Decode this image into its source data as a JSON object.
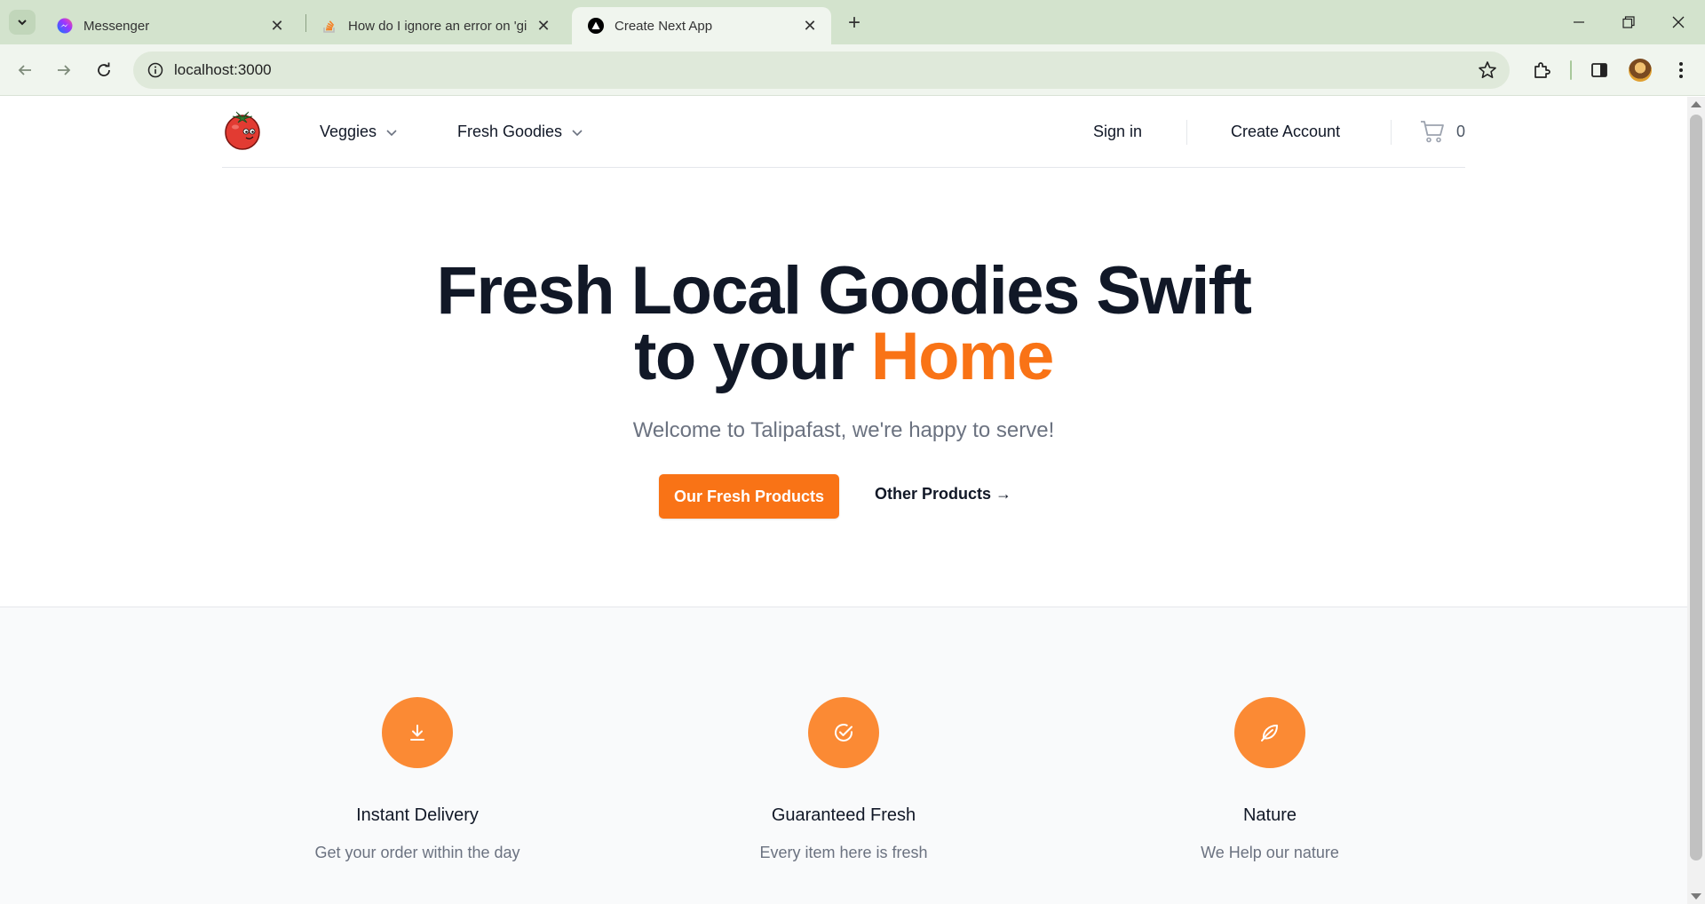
{
  "browser": {
    "tabs": [
      {
        "title": "Messenger",
        "icon": "messenger-icon",
        "active": false
      },
      {
        "title": "How do I ignore an error on 'gi",
        "icon": "stackoverflow-icon",
        "active": false
      },
      {
        "title": "Create Next App",
        "icon": "nextjs-icon",
        "active": true
      }
    ],
    "url": "localhost:3000"
  },
  "site": {
    "nav": {
      "items": [
        {
          "label": "Veggies"
        },
        {
          "label": "Fresh Goodies"
        }
      ],
      "sign_in": "Sign in",
      "create_account": "Create Account",
      "cart_count": "0"
    },
    "hero": {
      "title_line1": "Fresh Local Goodies Swift",
      "title_line2_prefix": "to your ",
      "title_line2_accent": "Home",
      "subtitle": "Welcome to Talipafast, we're happy to serve!",
      "primary_button": "Our Fresh Products",
      "secondary_link": "Other Products →"
    },
    "features": [
      {
        "icon": "download-arrow-icon",
        "title": "Instant Delivery",
        "description": "Get your order within the day"
      },
      {
        "icon": "check-circle-icon",
        "title": "Guaranteed Fresh",
        "description": "Every item here is fresh"
      },
      {
        "icon": "leaf-icon",
        "title": "Nature",
        "description": "We Help our nature"
      }
    ]
  },
  "colors": {
    "accent": "#f97316",
    "feature_circle": "#fb8a34",
    "heading": "#111827",
    "muted": "#6b7280",
    "tabbar": "#d3e3cd"
  }
}
